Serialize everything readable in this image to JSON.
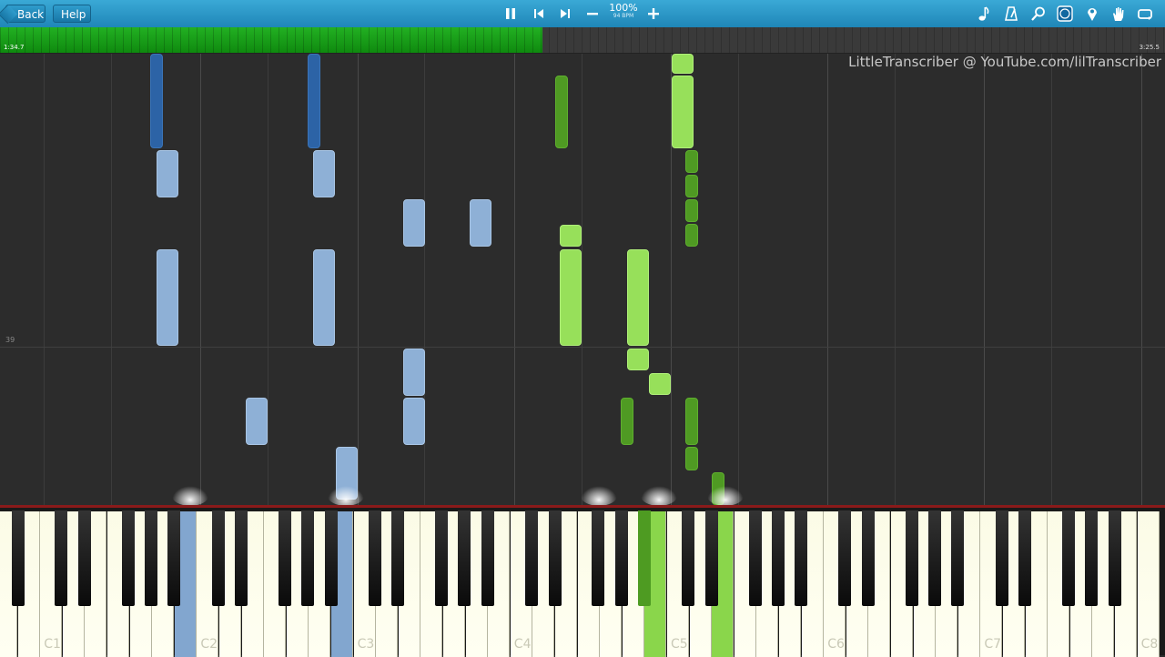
{
  "toolbar": {
    "back_label": "Back",
    "help_label": "Help",
    "tempo_percent": "100%",
    "tempo_bpm": "94 BPM",
    "transport_icons": [
      "pause-icon",
      "rewind-icon",
      "forward-icon",
      "minus-icon",
      "plus-icon"
    ],
    "right_icons": [
      "note-icon",
      "metronome-icon",
      "magnifier-icon",
      "keyboard-labels-icon",
      "marker-icon",
      "hand-icon",
      "loop-icon"
    ]
  },
  "progress": {
    "current_time": "1:34.7",
    "total_time": "3:25.5",
    "fraction": 0.466,
    "color": "#1a9e1a"
  },
  "roll": {
    "watermark": "LittleTranscriber @ YouTube.com/lilTranscriber",
    "measure_number": "39",
    "colors": {
      "left_light": "#8eb0d6",
      "left_dark": "#2c63a6",
      "right_light": "#97e05a",
      "right_dark": "#4f9a23"
    }
  },
  "keyboard": {
    "octave_labels": [
      "C1",
      "C2",
      "C3",
      "C4",
      "C5",
      "C6",
      "C7",
      "C8"
    ],
    "pressed_hands": [
      "left",
      "left",
      "right",
      "right",
      "right"
    ]
  }
}
